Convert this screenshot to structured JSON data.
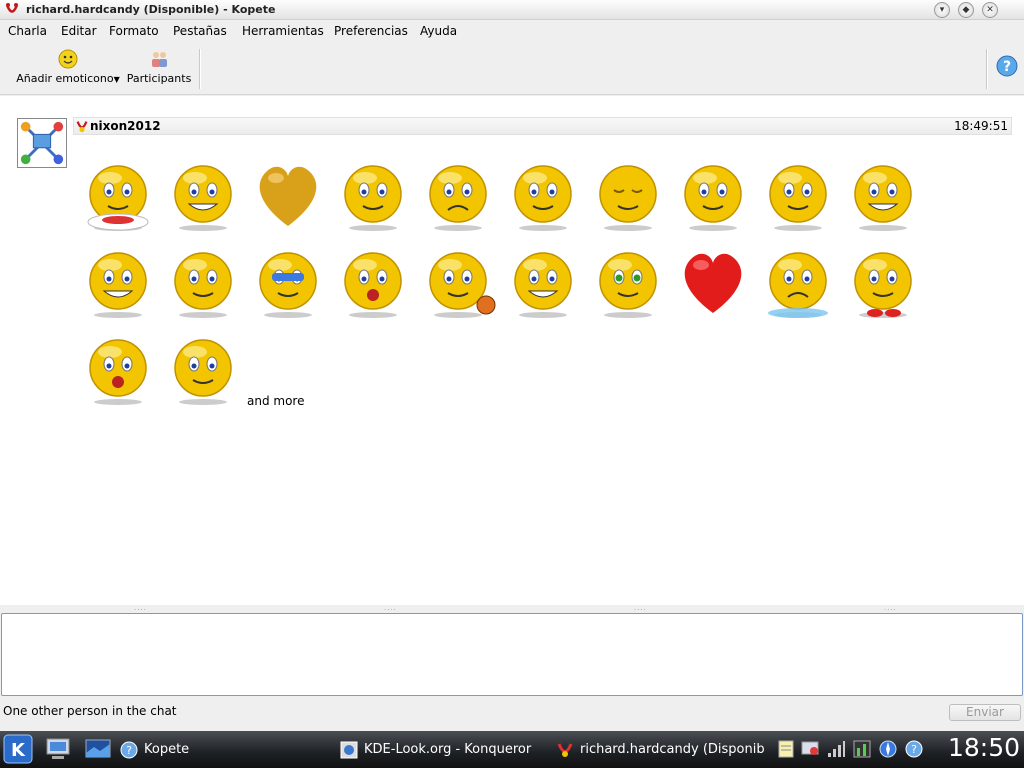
{
  "window": {
    "title": "richard.hardcandy (Disponible) - Kopete"
  },
  "menubar": {
    "items": [
      "Charla",
      "Editar",
      "Formato",
      "Pestañas",
      "Herramientas",
      "Preferencias",
      "Ayuda"
    ]
  },
  "toolbar": {
    "add_emoticon_label": "Añadir emoticono",
    "participants_label": "Participants"
  },
  "chat": {
    "sender": "nixon2012",
    "time": "18:49:51",
    "emoticons": [
      "spaghetti",
      "grin-wave",
      "heart-gold",
      "tired-drink",
      "worried-thumbs-down",
      "reading",
      "content",
      "hand-face",
      "pole-dancer",
      "grimace",
      "phone-grin",
      "cellphone-talk",
      "sunglasses-cool",
      "beer-drinker",
      "basketball",
      "birthday-cake",
      "green-eyes",
      "red-heart",
      "crying-puddle",
      "sneakers-stand",
      "shocked-sweat",
      "shrug"
    ],
    "and_more": "and more"
  },
  "status": {
    "text": "One other person in the chat",
    "send_label": "Enviar"
  },
  "taskbar": {
    "tasks": [
      {
        "label": "Kopete",
        "icon": "kopete-icon"
      },
      {
        "label": "KDE-Look.org - Konqueror",
        "icon": "konqueror-icon"
      },
      {
        "label": "richard.hardcandy (Disponible",
        "icon": "kopete-chat-icon"
      }
    ],
    "clock": "18:50"
  },
  "colors": {
    "accent": "#7b9ac7",
    "smiley": "#f2c500",
    "heart": "#e21b1b"
  }
}
